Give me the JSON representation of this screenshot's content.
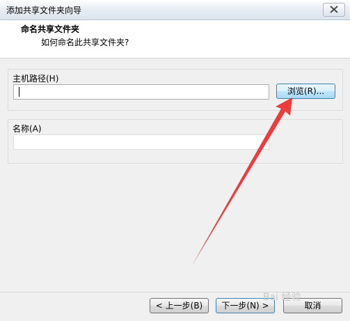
{
  "window": {
    "title": "添加共享文件夹向导"
  },
  "header": {
    "title": "命名共享文件夹",
    "subtitle": "如何命名此共享文件夹?"
  },
  "host_path": {
    "label": "主机路径(H)",
    "value": "",
    "browse_label": "浏览(R)..."
  },
  "name": {
    "label": "名称(A)",
    "value": ""
  },
  "footer": {
    "back_label": "< 上一步(B)",
    "next_label": "下一步(N) >",
    "cancel_label": "取消"
  },
  "annotation": {
    "arrow_color": "#ee3b3b"
  },
  "watermark": {
    "text": "Bai 经验"
  },
  "icons": {
    "close": "close-icon"
  }
}
